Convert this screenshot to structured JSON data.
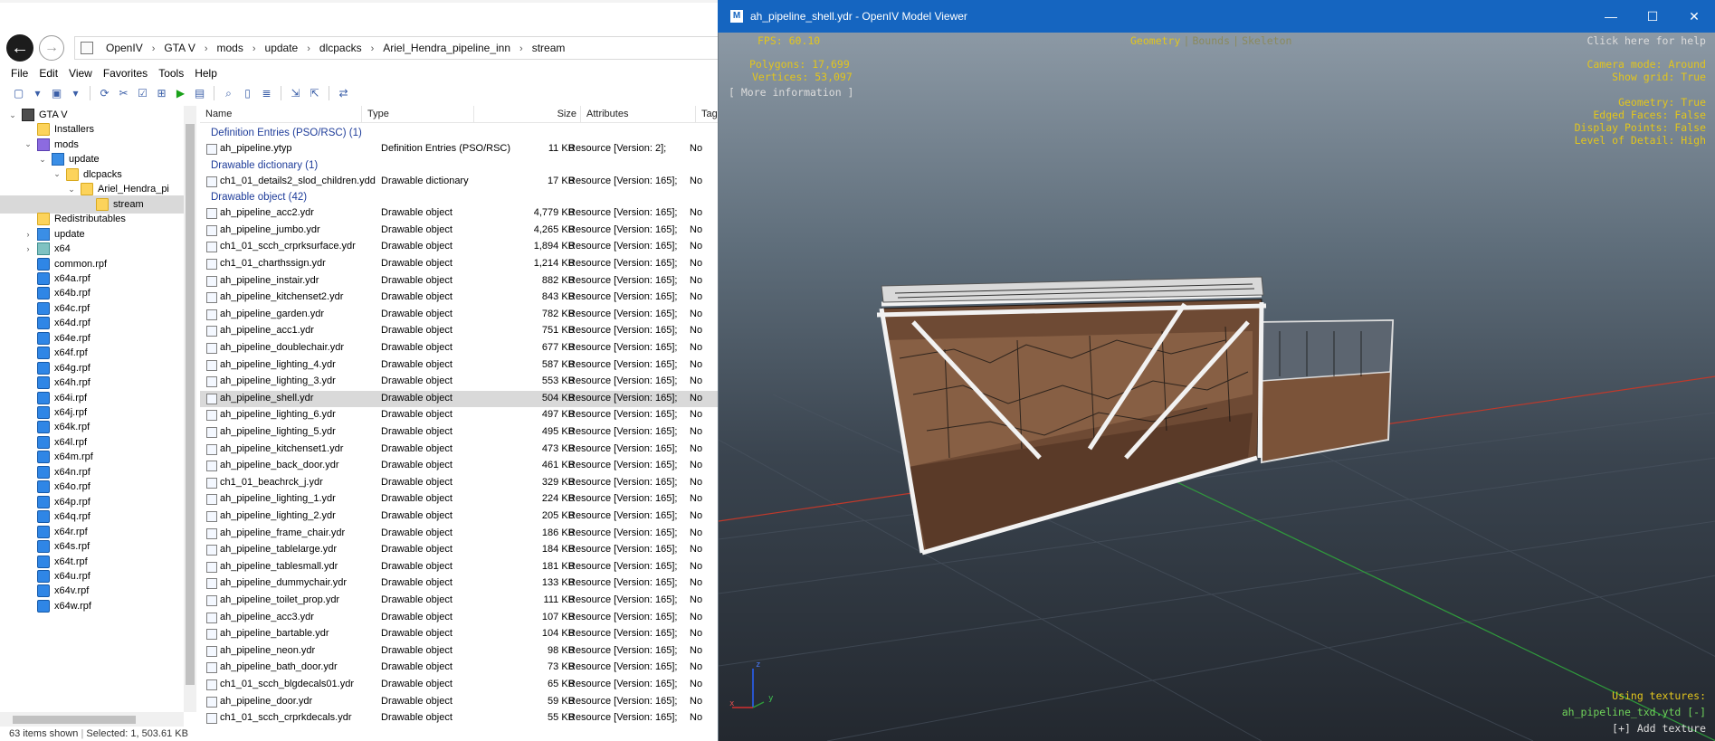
{
  "explorer": {
    "breadcrumbs": [
      "OpenIV",
      "GTA V",
      "mods",
      "update",
      "dlcpacks",
      "Ariel_Hendra_pipeline_inn",
      "stream"
    ],
    "menu": [
      "File",
      "Edit",
      "View",
      "Favorites",
      "Tools",
      "Help"
    ],
    "tree": [
      {
        "label": "GTA V",
        "icon": "game-icon",
        "arrow": "⌄"
      },
      {
        "label": "Installers",
        "icon": "folder-icon",
        "arrow": ""
      },
      {
        "label": "mods",
        "icon": "mods-folder-icon",
        "arrow": "⌄"
      },
      {
        "label": "update",
        "icon": "blue-folder-icon",
        "arrow": "⌄"
      },
      {
        "label": "dlcpacks",
        "icon": "folder-icon",
        "arrow": "⌄"
      },
      {
        "label": "Ariel_Hendra_pi",
        "icon": "folder-icon",
        "arrow": "⌄"
      },
      {
        "label": "stream",
        "icon": "folder-icon",
        "arrow": ""
      },
      {
        "label": "Redistributables",
        "icon": "folder-icon",
        "arrow": ""
      },
      {
        "label": "update",
        "icon": "blue-folder-icon",
        "arrow": "›"
      },
      {
        "label": "x64",
        "icon": "teal-folder-icon",
        "arrow": "›"
      },
      {
        "label": "common.rpf",
        "icon": "rpf-icon",
        "arrow": ""
      },
      {
        "label": "x64a.rpf",
        "icon": "rpf-icon",
        "arrow": ""
      },
      {
        "label": "x64b.rpf",
        "icon": "rpf-icon",
        "arrow": ""
      },
      {
        "label": "x64c.rpf",
        "icon": "rpf-icon",
        "arrow": ""
      },
      {
        "label": "x64d.rpf",
        "icon": "rpf-icon",
        "arrow": ""
      },
      {
        "label": "x64e.rpf",
        "icon": "rpf-icon",
        "arrow": ""
      },
      {
        "label": "x64f.rpf",
        "icon": "rpf-icon",
        "arrow": ""
      },
      {
        "label": "x64g.rpf",
        "icon": "rpf-icon",
        "arrow": ""
      },
      {
        "label": "x64h.rpf",
        "icon": "rpf-icon",
        "arrow": ""
      },
      {
        "label": "x64i.rpf",
        "icon": "rpf-icon",
        "arrow": ""
      },
      {
        "label": "x64j.rpf",
        "icon": "rpf-icon",
        "arrow": ""
      },
      {
        "label": "x64k.rpf",
        "icon": "rpf-icon",
        "arrow": ""
      },
      {
        "label": "x64l.rpf",
        "icon": "rpf-icon",
        "arrow": ""
      },
      {
        "label": "x64m.rpf",
        "icon": "rpf-icon",
        "arrow": ""
      },
      {
        "label": "x64n.rpf",
        "icon": "rpf-icon",
        "arrow": ""
      },
      {
        "label": "x64o.rpf",
        "icon": "rpf-icon",
        "arrow": ""
      },
      {
        "label": "x64p.rpf",
        "icon": "rpf-icon",
        "arrow": ""
      },
      {
        "label": "x64q.rpf",
        "icon": "rpf-icon",
        "arrow": ""
      },
      {
        "label": "x64r.rpf",
        "icon": "rpf-icon",
        "arrow": ""
      },
      {
        "label": "x64s.rpf",
        "icon": "rpf-icon",
        "arrow": ""
      },
      {
        "label": "x64t.rpf",
        "icon": "rpf-icon",
        "arrow": ""
      },
      {
        "label": "x64u.rpf",
        "icon": "rpf-icon",
        "arrow": ""
      },
      {
        "label": "x64v.rpf",
        "icon": "rpf-icon",
        "arrow": ""
      },
      {
        "label": "x64w.rpf",
        "icon": "rpf-icon",
        "arrow": ""
      }
    ],
    "columns": [
      "Name",
      "Type",
      "Size",
      "Attributes",
      "Tags"
    ],
    "groups": [
      {
        "title": "Definition Entries (PSO/RSC) (1)",
        "files": [
          {
            "name": "ah_pipeline.ytyp",
            "type": "Definition Entries (PSO/RSC)",
            "size": "11 KB",
            "attr": "Resource [Version: 2];",
            "tag": "No"
          }
        ]
      },
      {
        "title": "Drawable dictionary (1)",
        "files": [
          {
            "name": "ch1_01_details2_slod_children.ydd",
            "type": "Drawable dictionary",
            "size": "17 KB",
            "attr": "Resource [Version: 165];",
            "tag": "No"
          }
        ]
      },
      {
        "title": "Drawable object (42)",
        "files": [
          {
            "name": "ah_pipeline_acc2.ydr",
            "size": "4,779 KB"
          },
          {
            "name": "ah_pipeline_jumbo.ydr",
            "size": "4,265 KB"
          },
          {
            "name": "ch1_01_scch_crprksurface.ydr",
            "size": "1,894 KB"
          },
          {
            "name": "ch1_01_charthssign.ydr",
            "size": "1,214 KB"
          },
          {
            "name": "ah_pipeline_instair.ydr",
            "size": "882 KB"
          },
          {
            "name": "ah_pipeline_kitchenset2.ydr",
            "size": "843 KB"
          },
          {
            "name": "ah_pipeline_garden.ydr",
            "size": "782 KB"
          },
          {
            "name": "ah_pipeline_acc1.ydr",
            "size": "751 KB"
          },
          {
            "name": "ah_pipeline_doublechair.ydr",
            "size": "677 KB"
          },
          {
            "name": "ah_pipeline_lighting_4.ydr",
            "size": "587 KB"
          },
          {
            "name": "ah_pipeline_lighting_3.ydr",
            "size": "553 KB"
          },
          {
            "name": "ah_pipeline_shell.ydr",
            "size": "504 KB",
            "selected": true
          },
          {
            "name": "ah_pipeline_lighting_6.ydr",
            "size": "497 KB"
          },
          {
            "name": "ah_pipeline_lighting_5.ydr",
            "size": "495 KB"
          },
          {
            "name": "ah_pipeline_kitchenset1.ydr",
            "size": "473 KB"
          },
          {
            "name": "ah_pipeline_back_door.ydr",
            "size": "461 KB"
          },
          {
            "name": "ch1_01_beachrck_j.ydr",
            "size": "329 KB"
          },
          {
            "name": "ah_pipeline_lighting_1.ydr",
            "size": "224 KB"
          },
          {
            "name": "ah_pipeline_lighting_2.ydr",
            "size": "205 KB"
          },
          {
            "name": "ah_pipeline_frame_chair.ydr",
            "size": "186 KB"
          },
          {
            "name": "ah_pipeline_tablelarge.ydr",
            "size": "184 KB"
          },
          {
            "name": "ah_pipeline_tablesmall.ydr",
            "size": "181 KB"
          },
          {
            "name": "ah_pipeline_dummychair.ydr",
            "size": "133 KB"
          },
          {
            "name": "ah_pipeline_toilet_prop.ydr",
            "size": "111 KB"
          },
          {
            "name": "ah_pipeline_acc3.ydr",
            "size": "107 KB"
          },
          {
            "name": "ah_pipeline_bartable.ydr",
            "size": "104 KB"
          },
          {
            "name": "ah_pipeline_neon.ydr",
            "size": "98 KB"
          },
          {
            "name": "ah_pipeline_bath_door.ydr",
            "size": "73 KB"
          },
          {
            "name": "ch1_01_scch_blgdecals01.ydr",
            "size": "65 KB"
          },
          {
            "name": "ah_pipeline_door.ydr",
            "size": "59 KB"
          },
          {
            "name": "ch1_01_scch_crprkdecals.ydr",
            "size": "55 KB"
          }
        ],
        "type": "Drawable object",
        "attr": "Resource [Version: 165];",
        "tag": "No"
      }
    ],
    "status": {
      "count": "63 items shown",
      "selected": "Selected: 1, 503.61 KB"
    }
  },
  "viewer": {
    "title": "ah_pipeline_shell.ydr - OpenIV Model Viewer",
    "app_icon": "M",
    "window_buttons": {
      "minimize": "—",
      "maximize": "☐",
      "close": "✕"
    },
    "hud": {
      "fps": "FPS: 60.10",
      "polygons": "Polygons: 17,699",
      "vertices": "Vertices: 53,097",
      "more_info": "[ More information ]",
      "tabs": [
        "Geometry",
        "Bounds",
        "Skeleton"
      ],
      "tab_sep": "|",
      "help": "Click here for help",
      "camera_mode": "Camera mode: Around",
      "show_grid": "Show grid: True",
      "geometry": "Geometry: True",
      "edged_faces": "Edged Faces: False",
      "display_points": "Display Points: False",
      "lod": "Level of Detail: High",
      "using_textures": "Using textures:",
      "texture_dict": "ah_pipeline_txd.ytd [-]",
      "add_texture": "[+] Add texture",
      "axis_z": "z",
      "axis_x": "x",
      "axis_y": "y"
    },
    "colors": {
      "titlebar": "#1565c0",
      "hud_text": "#e2c51d",
      "texture_link": "#6fd25a"
    }
  }
}
